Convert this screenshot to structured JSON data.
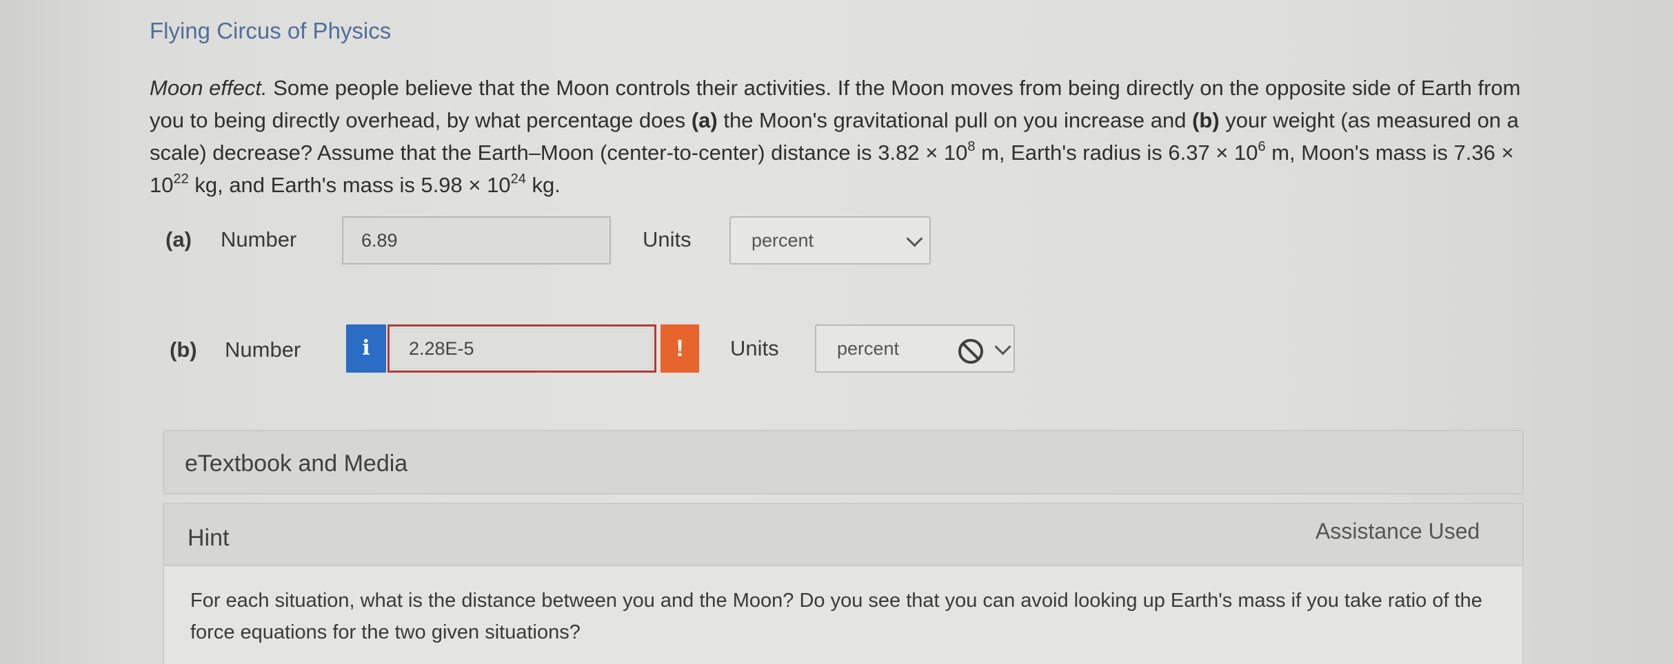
{
  "header": {
    "course_title": "Flying Circus of Physics"
  },
  "problem": {
    "lead": "Moon effect.",
    "text_1": " Some people believe that the Moon controls their activities. If the Moon moves from being directly on the opposite side of Earth from you to being directly overhead, by what percentage does ",
    "part_a_tag": "(a)",
    "text_2": " the Moon's gravitational pull on you increase and ",
    "part_b_tag": "(b)",
    "text_3": " your weight (as measured on a scale) decrease? Assume that the Earth–Moon (center-to-center) distance is 3.82 × 10",
    "exp_1": "8",
    "text_4": " m, Earth's radius is 6.37 × 10",
    "exp_2": "6",
    "text_5": " m, Moon's mass is 7.36 × 10",
    "exp_3": "22",
    "text_6": " kg, and Earth's mass is 5.98 × 10",
    "exp_4": "24",
    "text_7": " kg."
  },
  "part_a": {
    "tag": "(a)",
    "number_label": "Number",
    "value": "6.89",
    "units_label": "Units",
    "unit_selected": "percent"
  },
  "part_b": {
    "tag": "(b)",
    "number_label": "Number",
    "info_glyph": "i",
    "value": "2.28E-5",
    "warning_glyph": "!",
    "units_label": "Units",
    "unit_selected": "percent"
  },
  "etextbook": {
    "title": "eTextbook and Media"
  },
  "hint": {
    "title": "Hint",
    "assistance_status": "Assistance Used",
    "text": "For each situation, what is the distance between you and the Moon? Do you see that you can avoid looking up Earth's mass if you take ratio of the force equations for the two given situations?"
  },
  "colors": {
    "title_blue": "#4f6f9a",
    "info_blue": "#2b6cc4",
    "warning_orange": "#e8642d",
    "error_red": "#b23a3a"
  },
  "icons": [
    "info-icon",
    "warning-icon",
    "chevron-down-icon",
    "not-allowed-icon"
  ]
}
